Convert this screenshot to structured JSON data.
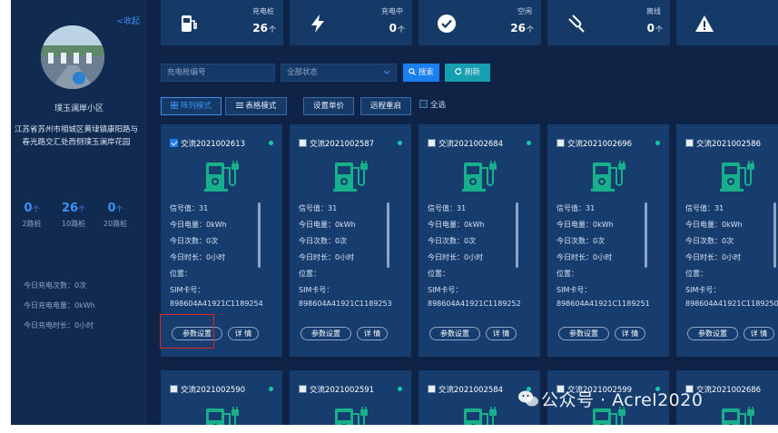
{
  "sidebar": {
    "collapse_label": "<收起",
    "station_name": "璞玉澜岸小区",
    "address_line1": "江苏省苏州市相城区黄埭镇康阳路与",
    "address_line2": "春光路交汇处西侧璞玉澜岸花园",
    "piles": [
      {
        "value": "0",
        "unit": "个",
        "label": "2路桩"
      },
      {
        "value": "26",
        "unit": "个",
        "label": "10路桩"
      },
      {
        "value": "0",
        "unit": "个",
        "label": "20路桩"
      }
    ],
    "today_count": "今日充电次数：0次",
    "today_energy": "今日充电电量：0kWh",
    "today_duration": "今日充电时长：0小时"
  },
  "stats": [
    {
      "label": "充电桩",
      "value": "26",
      "unit": "个",
      "icon": "charger-icon"
    },
    {
      "label": "充电中",
      "value": "0",
      "unit": "个",
      "icon": "lightning-icon"
    },
    {
      "label": "空闲",
      "value": "26",
      "unit": "个",
      "icon": "check-circle-icon"
    },
    {
      "label": "离线",
      "value": "0",
      "unit": "个",
      "icon": "offline-plug-icon"
    },
    {
      "label": "",
      "value": "",
      "unit": "",
      "icon": "warning-icon"
    }
  ],
  "toolbar": {
    "pile_no_placeholder": "充电枪编号",
    "status_select": "全部状态",
    "search_label": "搜索",
    "refresh_label": "刷新",
    "array_mode_label": "阵列模式",
    "table_mode_label": "表格模式",
    "set_price_label": "设置单价",
    "remote_restart_label": "远程重启",
    "select_all_label": "全选"
  },
  "card_labels": {
    "signal": "信号值：31",
    "energy": "今日电量：0kWh",
    "count": "今日次数：0次",
    "duration": "今日时长：0小时",
    "location": "位置：",
    "sim_label": "SIM卡号：",
    "params_button": "参数设置",
    "detail_button": "详 情"
  },
  "cards": [
    {
      "title": "交流2021002613",
      "sim": "898604A41921C1189254",
      "checked": true
    },
    {
      "title": "交流2021002587",
      "sim": "898604A41921C1189253",
      "checked": false
    },
    {
      "title": "交流2021002684",
      "sim": "898604A41921C1189252",
      "checked": false
    },
    {
      "title": "交流2021002696",
      "sim": "898604A41921C1189251",
      "checked": false
    },
    {
      "title": "交流2021002586",
      "sim": "898604A41921C1189250",
      "checked": false
    },
    {
      "title": "交流2021002590",
      "checked": false
    },
    {
      "title": "交流2021002591",
      "checked": false
    },
    {
      "title": "交流2021002584",
      "checked": false
    },
    {
      "title": "交流2021002599",
      "checked": false
    },
    {
      "title": "交流2021002686",
      "checked": false
    }
  ],
  "watermark": "公众号 · Acrel2020",
  "colors": {
    "accent": "#1a7ff0",
    "status_online": "#17c8a8",
    "highlight": "#e02424",
    "icon_green": "#17b08a"
  }
}
